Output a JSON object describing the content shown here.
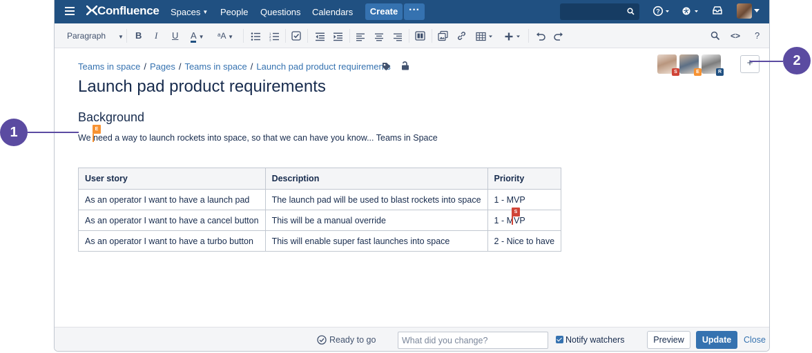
{
  "nav": {
    "logo": "Confluence",
    "spaces": "Spaces",
    "people": "People",
    "questions": "Questions",
    "calendars": "Calendars",
    "create": "Create",
    "more": "···",
    "search_placeholder": ""
  },
  "toolbar": {
    "paragraph": "Paragraph"
  },
  "page": {
    "breadcrumb": [
      "Teams in space",
      "Pages",
      "Teams in space",
      "Launch pad product requirements"
    ],
    "title": "Launch pad product requirements",
    "heading": "Background",
    "paragraph": "We need a way to launch rockets into space, so that we can have you know... Teams in Space"
  },
  "collaborators": [
    {
      "badge": "S",
      "color": "#d04437"
    },
    {
      "badge": "E",
      "color": "#f79232"
    },
    {
      "badge": "R",
      "color": "#205081"
    }
  ],
  "cursors": {
    "e": "E",
    "s": "S"
  },
  "table": {
    "headers": [
      "User story",
      "Description",
      "Priority"
    ],
    "rows": [
      [
        "As an operator I want to have a launch pad",
        "The launch pad will be used to blast rockets into space",
        "1 - MVP"
      ],
      [
        "As an operator I want to have a cancel button",
        "This will be a manual override",
        "1 - MVP"
      ],
      [
        "As an operator I want to have a turbo button",
        "This will enable super fast launches into space",
        "2 - Nice to have"
      ]
    ]
  },
  "footer": {
    "ready": "Ready to go",
    "change_placeholder": "What did you change?",
    "notify": "Notify watchers",
    "preview": "Preview",
    "update": "Update",
    "close": "Close"
  },
  "callouts": {
    "one": "1",
    "two": "2"
  },
  "colors": {
    "nav_bg": "#205081",
    "primary": "#3572b0",
    "callout": "#5b4ba1",
    "badge_e": "#f79232",
    "badge_s": "#d04437"
  }
}
